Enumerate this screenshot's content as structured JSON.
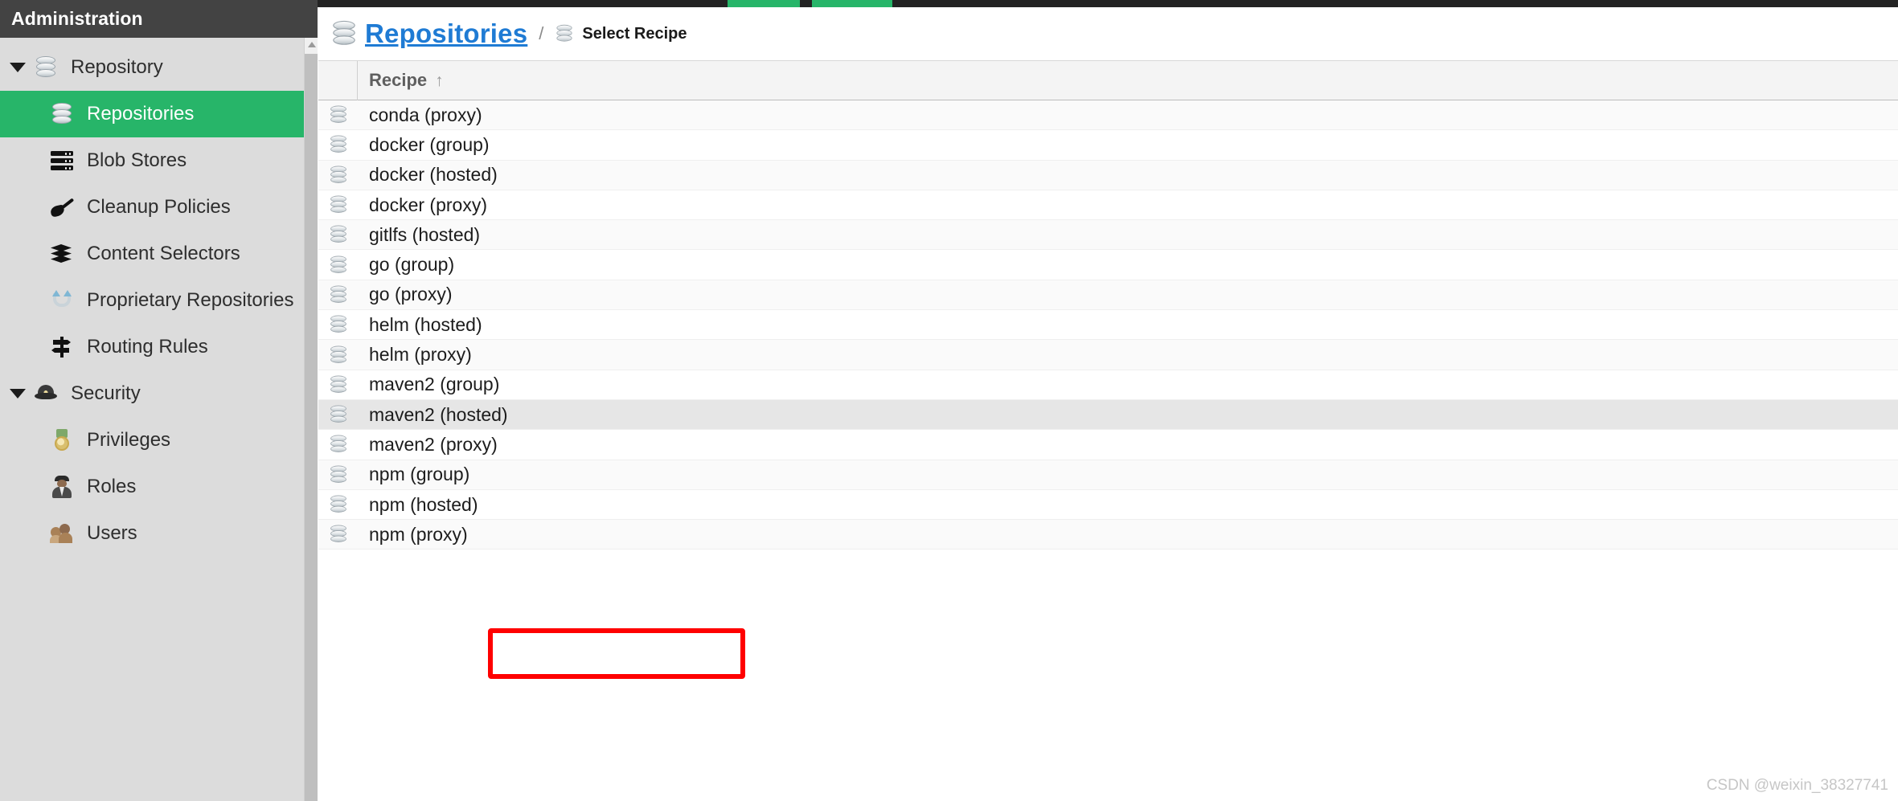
{
  "sidebar": {
    "header_title": "Administration",
    "groups": [
      {
        "label": "Repository",
        "icon": "database-icon",
        "expanded": true,
        "items": [
          {
            "label": "Repositories",
            "icon": "database-icon",
            "active": true
          },
          {
            "label": "Blob Stores",
            "icon": "server-stack-icon",
            "active": false
          },
          {
            "label": "Cleanup Policies",
            "icon": "broom-icon",
            "active": false
          },
          {
            "label": "Content Selectors",
            "icon": "layers-icon",
            "active": false
          },
          {
            "label": "Proprietary Repositories",
            "icon": "magnet-arrows-icon",
            "active": false
          },
          {
            "label": "Routing Rules",
            "icon": "signpost-icon",
            "active": false
          }
        ]
      },
      {
        "label": "Security",
        "icon": "police-hat-icon",
        "expanded": true,
        "items": [
          {
            "label": "Privileges",
            "icon": "medal-icon",
            "active": false
          },
          {
            "label": "Roles",
            "icon": "officer-icon",
            "active": false
          },
          {
            "label": "Users",
            "icon": "users-icon",
            "active": false
          }
        ]
      }
    ]
  },
  "breadcrumb": {
    "root_icon": "database-icon",
    "root_label": "Repositories",
    "separator": "/",
    "current_icon": "database-icon",
    "current_label": "Select Recipe"
  },
  "table": {
    "columns": [
      {
        "key": "icon",
        "label": ""
      },
      {
        "key": "recipe",
        "label": "Recipe",
        "sort": "↑"
      }
    ],
    "rows": [
      {
        "icon": "database-icon",
        "recipe": "conda (proxy)",
        "shaded": false
      },
      {
        "icon": "database-icon",
        "recipe": "docker (group)",
        "shaded": false
      },
      {
        "icon": "database-icon",
        "recipe": "docker (hosted)",
        "shaded": false
      },
      {
        "icon": "database-icon",
        "recipe": "docker (proxy)",
        "shaded": false
      },
      {
        "icon": "database-icon",
        "recipe": "gitlfs (hosted)",
        "shaded": false
      },
      {
        "icon": "database-icon",
        "recipe": "go (group)",
        "shaded": false
      },
      {
        "icon": "database-icon",
        "recipe": "go (proxy)",
        "shaded": false
      },
      {
        "icon": "database-icon",
        "recipe": "helm (hosted)",
        "shaded": false
      },
      {
        "icon": "database-icon",
        "recipe": "helm (proxy)",
        "shaded": false
      },
      {
        "icon": "database-icon",
        "recipe": "maven2 (group)",
        "shaded": false
      },
      {
        "icon": "database-icon",
        "recipe": "maven2 (hosted)",
        "shaded": true
      },
      {
        "icon": "database-icon",
        "recipe": "maven2 (proxy)",
        "shaded": false,
        "highlighted": true
      },
      {
        "icon": "database-icon",
        "recipe": "npm (group)",
        "shaded": false
      },
      {
        "icon": "database-icon",
        "recipe": "npm (hosted)",
        "shaded": false
      },
      {
        "icon": "database-icon",
        "recipe": "npm (proxy)",
        "shaded": false
      }
    ]
  },
  "watermark": {
    "text": "CSDN @weixin_38327741"
  },
  "colors": {
    "accent_green": "#27b569",
    "link_blue": "#1f7bd4",
    "sidebar_bg": "#dcdcdc",
    "header_bg": "#434343",
    "highlight_red": "#ff0000"
  }
}
